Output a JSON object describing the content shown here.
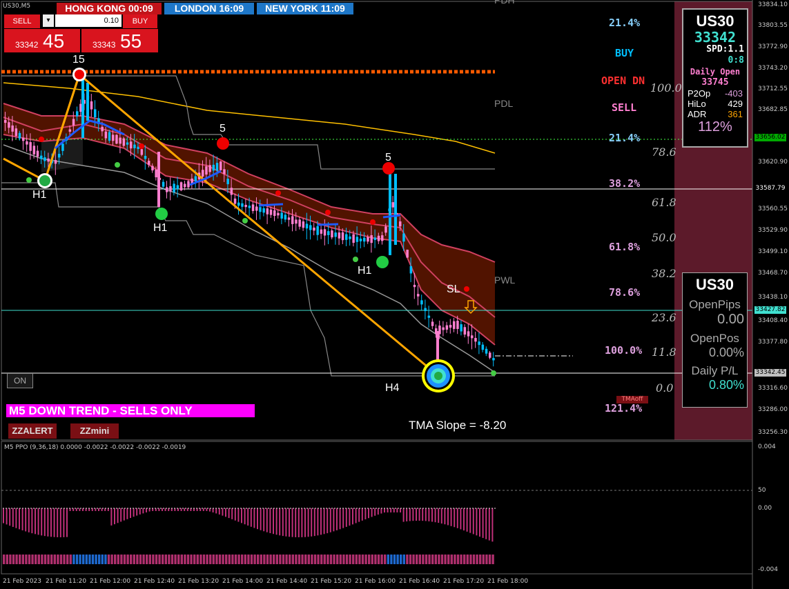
{
  "window": {
    "symbol": "US30,M5"
  },
  "sessions": [
    {
      "label": "HONG KONG  00:09",
      "bg": "#c2141a"
    },
    {
      "label": "LONDON   16:09",
      "bg": "#1e77c8"
    },
    {
      "label": "NEW YORK  11:09",
      "bg": "#1e77c8"
    }
  ],
  "trade": {
    "sell_label": "SELL",
    "buy_label": "BUY",
    "lot": "0.10",
    "bid_small": "33342",
    "bid_big": "45",
    "ask_small": "33343",
    "ask_big": "55"
  },
  "zz_labels": {
    "top": "15",
    "h1a": "H1",
    "five_a": "5",
    "h1b": "H1",
    "five_b": "5",
    "h1c": "H1",
    "h4": "H4",
    "sl": "SL"
  },
  "level_labels": {
    "pdh": "PDH",
    "pdl": "PDL",
    "pwl": "PWL"
  },
  "fib_left": [
    {
      "text": "21.4%",
      "color": "#87cefa"
    },
    {
      "text": "BUY",
      "color": "#00bfff"
    },
    {
      "text": "OPEN DN",
      "color": "#ff3030"
    },
    {
      "text": "SELL",
      "color": "#ff7fd0"
    },
    {
      "text": "21.4%",
      "color": "#87cefa"
    },
    {
      "text": "38.2%",
      "color": "#dda0dd"
    },
    {
      "text": "61.8%",
      "color": "#dda0dd"
    },
    {
      "text": "78.6%",
      "color": "#dda0dd"
    },
    {
      "text": "100.0%",
      "color": "#dda0dd"
    },
    {
      "text": "121.4%",
      "color": "#dda0dd"
    }
  ],
  "fib_right": [
    "100.0",
    "78.6",
    "61.8",
    "50.0",
    "38.2",
    "23.6",
    "11.8",
    "0.0"
  ],
  "panel_quote": {
    "symbol": "US30",
    "price": "33342",
    "spread": "SPD:1.1",
    "ratio": "0:8",
    "daily_open_label": "Daily Open",
    "daily_open": "33745",
    "rows": [
      [
        "P2Op",
        "-403"
      ],
      [
        "HiLo",
        "429"
      ],
      [
        "ADR",
        "361"
      ]
    ],
    "adr_pct": "112%"
  },
  "panel_pips": {
    "symbol": "US30",
    "open_pips_label": "OpenPips",
    "open_pips": "0.00",
    "open_pos_label": "OpenPos",
    "open_pos": "0.00%",
    "daily_pl_label": "Daily P/L",
    "daily_pl": "0.80%"
  },
  "trend": {
    "text": "M5  DOWN TREND - SELLS ONLY"
  },
  "buttons": {
    "on": "ON",
    "zzalert": "ZZALERT",
    "zzmini": "ZZmini",
    "tma_tag": "TMAoff"
  },
  "tma_slope": "TMA Slope = -8.20",
  "indicator": {
    "label": "M5 PPO (9,36,18) 0.0000 -0.0022 -0.0022 -0.0022 -0.0019",
    "ticks": [
      "0.004",
      "50",
      "0.00",
      "-0.004"
    ]
  },
  "price_axis": [
    "33834.10",
    "33803.55",
    "33772.90",
    "33743.20",
    "33712.55",
    "33682.85",
    "33656.02",
    "33620.90",
    "33587.79",
    "33560.55",
    "33529.90",
    "33499.10",
    "33468.70",
    "33438.10",
    "33427.82",
    "33408.40",
    "33377.80",
    "33342.45",
    "33316.60",
    "33286.00",
    "33256.30"
  ],
  "price_tags": [
    {
      "text": "33656.02",
      "bg": "#00aa00",
      "color": "#000"
    },
    {
      "text": "33587.79",
      "bg": "#000",
      "color": "#fff"
    },
    {
      "text": "33427.82",
      "bg": "#40e0d0",
      "color": "#000"
    },
    {
      "text": "33342.45",
      "bg": "#c0c0c0",
      "color": "#000"
    }
  ],
  "time_axis": [
    "21 Feb 2023",
    "21 Feb 11:20",
    "21 Feb 12:00",
    "21 Feb 12:40",
    "21 Feb 13:20",
    "21 Feb 14:00",
    "21 Feb 14:40",
    "21 Feb 15:20",
    "21 Feb 16:00",
    "21 Feb 16:40",
    "21 Feb 17:20",
    "21 Feb 18:00"
  ],
  "colors": {
    "bull": "#00bfff",
    "bear": "#ff7fd0",
    "zigzag": "#ffa500",
    "channel": "#5a1500",
    "right_band": "#5c1a2a"
  }
}
